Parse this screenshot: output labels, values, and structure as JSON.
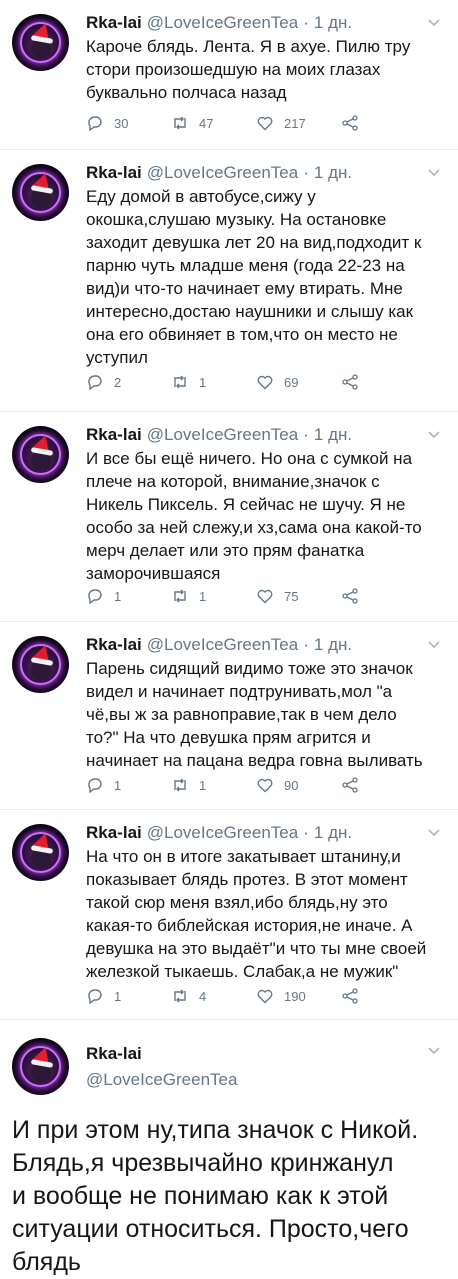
{
  "author": {
    "name": "Rka-lai",
    "handle": "@LoveIceGreenTea",
    "time": "1 дн."
  },
  "tweets": [
    {
      "text": "Кароче блядь. Лента. Я в ахуе. Пилю тру\nстори произошедшую на моих глазах\nбуквально полчаса назад",
      "replies": "30",
      "retweets": "47",
      "likes": "217"
    },
    {
      "text": "Еду домой в автобусе,сижу у\nокошка,слушаю музыку. На остановке\nзаходит девушка лет 20 на вид,подходит к\nпарню чуть младше меня (года 22-23 на\nвид)и что-то начинает ему втирать. Мне\nинтересно,достаю наушники и слышу как\nона его обвиняет в том,что он место не\nуступил",
      "replies": "2",
      "retweets": "1",
      "likes": "69"
    },
    {
      "text": "И все бы ещё ничего. Но она с сумкой на\nплече на которой, внимание,значок с\nНикель Пиксель. Я сейчас не шучу. Я не\nособо за ней слежу,и хз,сама она какой-то\nмерч делает или это прям фанатка\nзаморочившаяся",
      "replies": "1",
      "retweets": "1",
      "likes": "75"
    },
    {
      "text": "Парень сидящий видимо тоже это значок\nвидел и начинает подтрунивать,мол \"а\nчё,вы ж за равноправие,так в чем дело\nто?\" На что девушка прям агрится и\nначинает на пацана ведра говна выливать",
      "replies": "1",
      "retweets": "1",
      "likes": "90"
    },
    {
      "text": "На что он в итоге закатывает штанину,и\nпоказывает блядь протез. В этот момент\nтакой сюр меня взял,ибо блядь,ну это\nкакая-то библейская история,не иначе. А\nдевушка на это выдаёт\"и что ты мне своей\nжелезкой тыкаешь. Слабак,а не мужик\"",
      "replies": "1",
      "retweets": "4",
      "likes": "190"
    }
  ],
  "final": {
    "text": "И при этом ну,типа значок с Никой.\nБлядь,я чрезвычайно кринжанул\nи вообще не понимаю как к этой\nситуации относиться. Просто,чего\nблядь"
  },
  "icons": [
    "reply-icon",
    "retweet-icon",
    "like-icon",
    "share-icon",
    "chevron-down-icon"
  ],
  "colors": {
    "text": "#14171a",
    "secondary": "#657786",
    "divider": "#e6ecf0"
  }
}
